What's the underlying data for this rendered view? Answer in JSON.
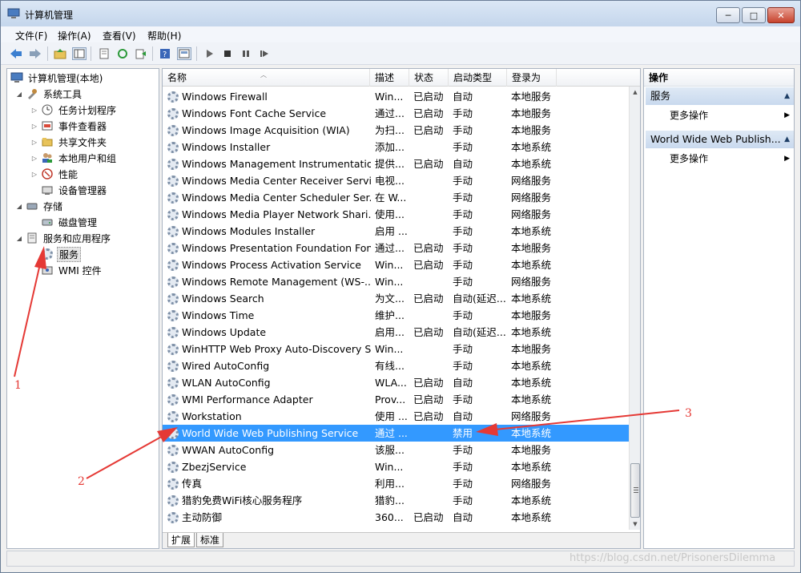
{
  "window": {
    "title": "计算机管理",
    "controls": {
      "minimize": "─",
      "maximize": "□",
      "close": "✕"
    }
  },
  "menubar": {
    "items": [
      "文件(F)",
      "操作(A)",
      "查看(V)",
      "帮助(H)"
    ]
  },
  "toolbar": {
    "icons": [
      "back-arrow-icon",
      "forward-arrow-icon",
      "up-folder-icon",
      "show-tree-icon",
      "properties-icon",
      "refresh-icon",
      "export-icon",
      "help-icon",
      "console-icon",
      "play-icon",
      "stop-icon",
      "pause-icon",
      "restart-icon"
    ]
  },
  "tree": {
    "root": "计算机管理(本地)",
    "system_tools": "系统工具",
    "task_scheduler": "任务计划程序",
    "event_viewer": "事件查看器",
    "shared_folders": "共享文件夹",
    "local_users": "本地用户和组",
    "performance": "性能",
    "device_manager": "设备管理器",
    "storage": "存储",
    "disk_management": "磁盘管理",
    "services_apps": "服务和应用程序",
    "services": "服务",
    "wmi": "WMI 控件"
  },
  "list": {
    "columns": {
      "name": "名称",
      "desc": "描述",
      "status": "状态",
      "startup": "启动类型",
      "logon": "登录为"
    },
    "rows": [
      {
        "name": "Windows Firewall",
        "desc": "Win...",
        "status": "已启动",
        "startup": "自动",
        "logon": "本地服务"
      },
      {
        "name": "Windows Font Cache Service",
        "desc": "通过...",
        "status": "已启动",
        "startup": "手动",
        "logon": "本地服务"
      },
      {
        "name": "Windows Image Acquisition (WIA)",
        "desc": "为扫...",
        "status": "已启动",
        "startup": "手动",
        "logon": "本地服务"
      },
      {
        "name": "Windows Installer",
        "desc": "添加...",
        "status": "",
        "startup": "手动",
        "logon": "本地系统"
      },
      {
        "name": "Windows Management Instrumentation",
        "desc": "提供...",
        "status": "已启动",
        "startup": "自动",
        "logon": "本地系统"
      },
      {
        "name": "Windows Media Center Receiver Servi...",
        "desc": "电视...",
        "status": "",
        "startup": "手动",
        "logon": "网络服务"
      },
      {
        "name": "Windows Media Center Scheduler Ser...",
        "desc": "在 W...",
        "status": "",
        "startup": "手动",
        "logon": "网络服务"
      },
      {
        "name": "Windows Media Player Network Shari...",
        "desc": "使用...",
        "status": "",
        "startup": "手动",
        "logon": "网络服务"
      },
      {
        "name": "Windows Modules Installer",
        "desc": "启用 ...",
        "status": "",
        "startup": "手动",
        "logon": "本地系统"
      },
      {
        "name": "Windows Presentation Foundation Fon...",
        "desc": "通过...",
        "status": "已启动",
        "startup": "手动",
        "logon": "本地服务"
      },
      {
        "name": "Windows Process Activation Service",
        "desc": "Win...",
        "status": "已启动",
        "startup": "手动",
        "logon": "本地系统"
      },
      {
        "name": "Windows Remote Management (WS-...",
        "desc": "Win...",
        "status": "",
        "startup": "手动",
        "logon": "网络服务"
      },
      {
        "name": "Windows Search",
        "desc": "为文...",
        "status": "已启动",
        "startup": "自动(延迟...",
        "logon": "本地系统"
      },
      {
        "name": "Windows Time",
        "desc": "维护...",
        "status": "",
        "startup": "手动",
        "logon": "本地服务"
      },
      {
        "name": "Windows Update",
        "desc": "启用...",
        "status": "已启动",
        "startup": "自动(延迟...",
        "logon": "本地系统"
      },
      {
        "name": "WinHTTP Web Proxy Auto-Discovery S...",
        "desc": "Win...",
        "status": "",
        "startup": "手动",
        "logon": "本地服务"
      },
      {
        "name": "Wired AutoConfig",
        "desc": "有线...",
        "status": "",
        "startup": "手动",
        "logon": "本地系统"
      },
      {
        "name": "WLAN AutoConfig",
        "desc": "WLA...",
        "status": "已启动",
        "startup": "自动",
        "logon": "本地系统"
      },
      {
        "name": "WMI Performance Adapter",
        "desc": "Prov...",
        "status": "已启动",
        "startup": "手动",
        "logon": "本地系统"
      },
      {
        "name": "Workstation",
        "desc": "使用 ...",
        "status": "已启动",
        "startup": "自动",
        "logon": "网络服务"
      },
      {
        "name": "World Wide Web Publishing Service",
        "desc": "通过 ...",
        "status": "",
        "startup": "禁用",
        "logon": "本地系统"
      },
      {
        "name": "WWAN AutoConfig",
        "desc": "该服...",
        "status": "",
        "startup": "手动",
        "logon": "本地服务"
      },
      {
        "name": "ZbezjService",
        "desc": "Win...",
        "status": "",
        "startup": "手动",
        "logon": "本地系统"
      },
      {
        "name": "传真",
        "desc": "利用...",
        "status": "",
        "startup": "手动",
        "logon": "网络服务"
      },
      {
        "name": "猎豹免费WiFi核心服务程序",
        "desc": "猎豹...",
        "status": "",
        "startup": "手动",
        "logon": "本地系统"
      },
      {
        "name": "主动防御",
        "desc": "360...",
        "status": "已启动",
        "startup": "自动",
        "logon": "本地系统"
      }
    ],
    "selected_index": 20,
    "tabs": [
      "扩展",
      "标准"
    ]
  },
  "actions": {
    "title": "操作",
    "section1": "服务",
    "section1_item": "更多操作",
    "section2": "World Wide Web Publish...",
    "section2_item": "更多操作"
  },
  "annotations": [
    "1",
    "2",
    "3"
  ],
  "watermark": "https://blog.csdn.net/PrisonersDilemma",
  "colors": {
    "selection": "#3399ff",
    "annotation_red": "#e53935",
    "section_header": "#c9d9ee"
  }
}
